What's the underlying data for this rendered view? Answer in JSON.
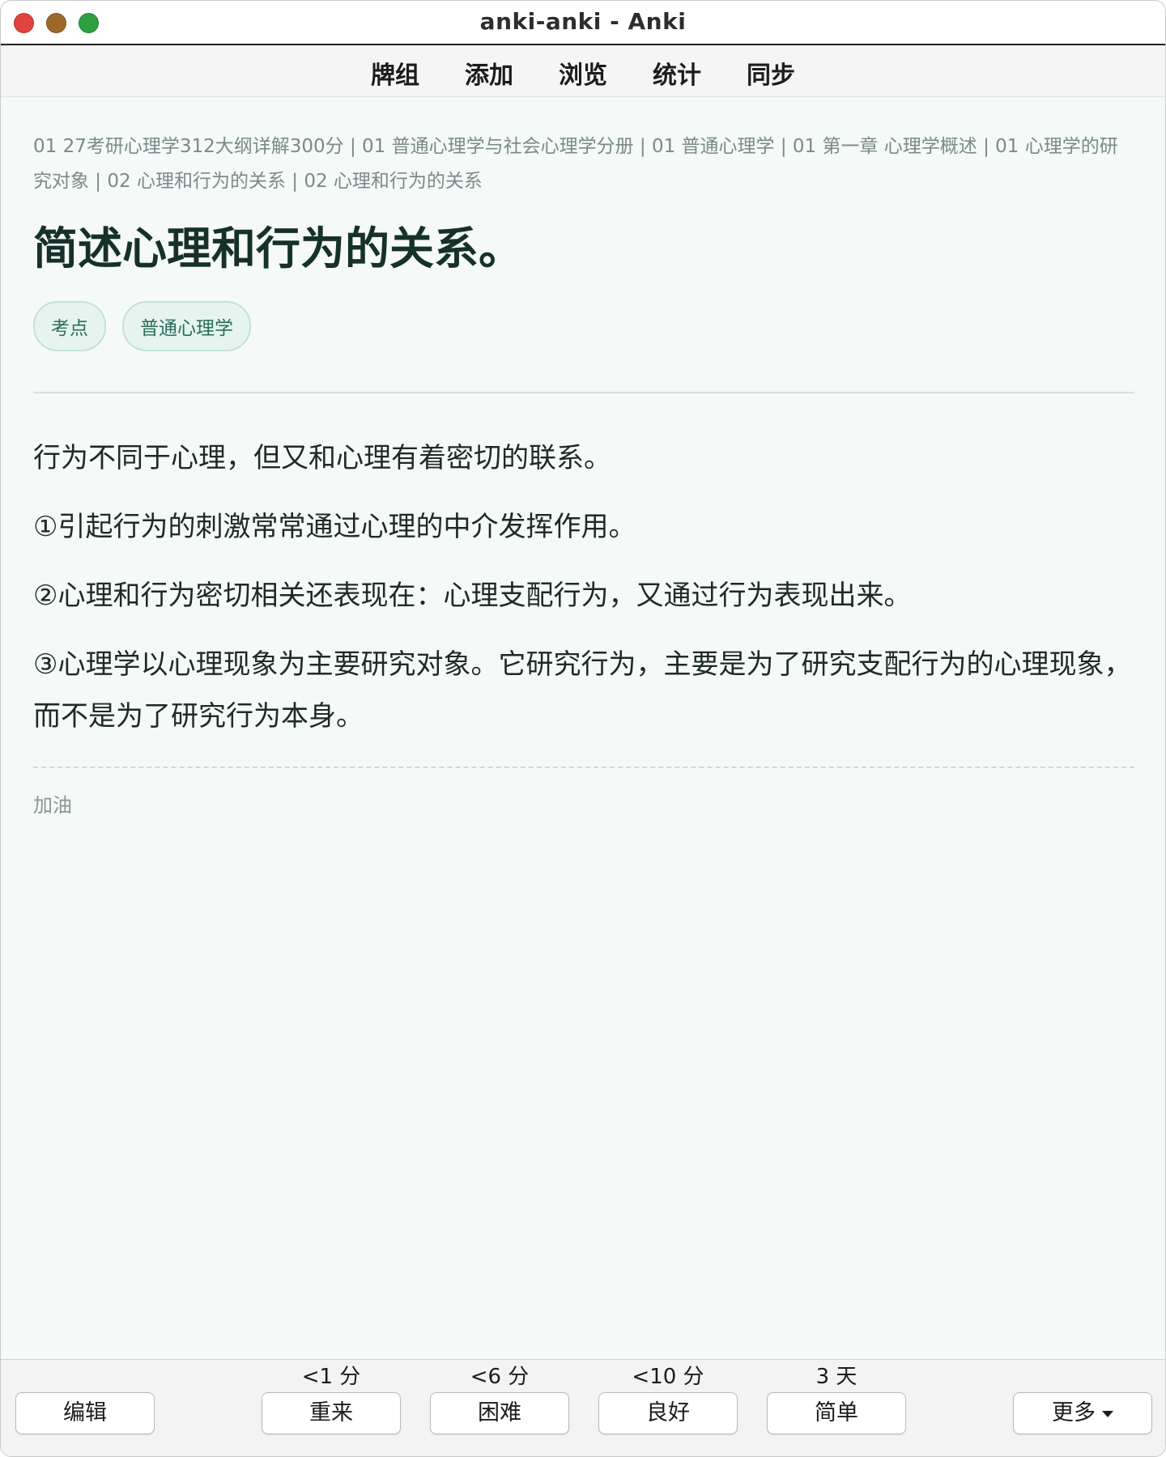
{
  "window": {
    "title": "anki-anki - Anki"
  },
  "nav": {
    "items": [
      "牌组",
      "添加",
      "浏览",
      "统计",
      "同步"
    ]
  },
  "card": {
    "deck_path": "01 27考研心理学312大纲详解300分 | 01 普通心理学与社会心理学分册 | 01 普通心理学 | 01 第一章 心理学概述 | 01 心理学的研究对象 | 02 心理和行为的关系 | 02 心理和行为的关系",
    "question": "简述心理和行为的关系。",
    "tags": [
      "考点",
      "普通心理学"
    ],
    "answer": [
      "行为不同于心理，但又和心理有着密切的联系。",
      "①引起行为的刺激常常通过心理的中介发挥作用。",
      "②心理和行为密切相关还表现在：心理支配行为，又通过行为表现出来。",
      "③心理学以心理现象为主要研究对象。它研究行为，主要是为了研究支配行为的心理现象，而不是为了研究行为本身。"
    ],
    "extra": "加油"
  },
  "bottom": {
    "edit_label": "编辑",
    "more_label": "更多",
    "answers": [
      {
        "label": "重来",
        "interval": "<1 分"
      },
      {
        "label": "困难",
        "interval": "<6 分"
      },
      {
        "label": "良好",
        "interval": "<10 分"
      },
      {
        "label": "简单",
        "interval": "3 天"
      }
    ]
  },
  "colors": {
    "background": "#f5f9f8",
    "question": "#16302a",
    "tag_text": "#2a6e5b",
    "tag_bg": "#e6f4ef",
    "meta_text": "#7a8a8a"
  },
  "icons": {
    "more_caret": "chevron-down-icon"
  }
}
